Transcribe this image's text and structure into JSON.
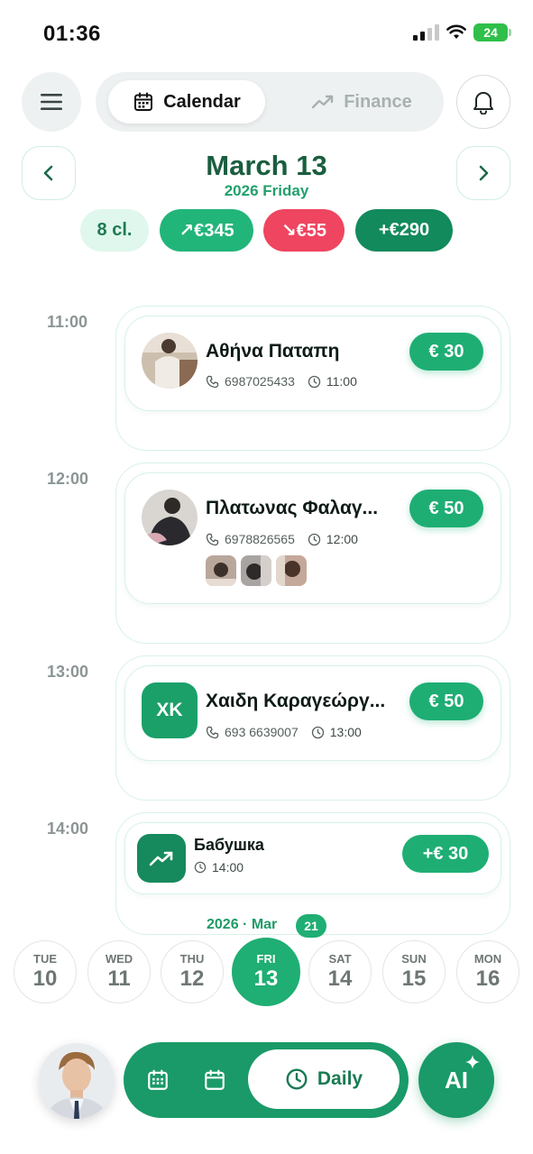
{
  "status": {
    "time": "01:36",
    "battery": "24"
  },
  "nav": {
    "menu_icon": "hamburger-icon",
    "tabs": [
      {
        "label": "Calendar",
        "icon": "calendar-icon",
        "active": true
      },
      {
        "label": "Finance",
        "icon": "trend-up-icon",
        "active": false
      }
    ],
    "bell_icon": "bell-icon"
  },
  "date_header": {
    "title": "March 13",
    "subtitle": "2026 Friday"
  },
  "summary": {
    "count": "8 cl.",
    "income": "↗€345",
    "expense": "↘€55",
    "net": "+€290"
  },
  "timeline": {
    "slots": [
      {
        "time": "11:00"
      },
      {
        "time": "12:00"
      },
      {
        "time": "13:00"
      },
      {
        "time": "14:00"
      }
    ],
    "appointments": [
      {
        "name": "Αθήνα Παταπη",
        "phone": "6987025433",
        "time": "11:00",
        "price": "€ 30"
      },
      {
        "name": "Πλατωνας Φαλαγ...",
        "phone": "6978826565",
        "time": "12:00",
        "price": "€ 50",
        "photos": 3
      },
      {
        "name": "Χαιδη Καραγεώργ...",
        "initials": "XK",
        "phone": "693 6639007",
        "time": "13:00",
        "price": "€ 50"
      }
    ],
    "finance": {
      "name": "Бабушка",
      "time": "14:00",
      "amount": "+€ 30"
    }
  },
  "week": {
    "label": "2026 · Mar",
    "badge": "21",
    "days": [
      {
        "name": "TUE",
        "num": "10"
      },
      {
        "name": "WED",
        "num": "11"
      },
      {
        "name": "THU",
        "num": "12"
      },
      {
        "name": "FRI",
        "num": "13",
        "active": true
      },
      {
        "name": "SAT",
        "num": "14"
      },
      {
        "name": "SUN",
        "num": "15"
      },
      {
        "name": "MON",
        "num": "16"
      }
    ]
  },
  "bottom": {
    "daily_label": "Daily",
    "ai_label": "AI"
  },
  "colors": {
    "accent": "#1fae73",
    "dark_green": "#1a5e3f",
    "expense": "#ef4560"
  }
}
